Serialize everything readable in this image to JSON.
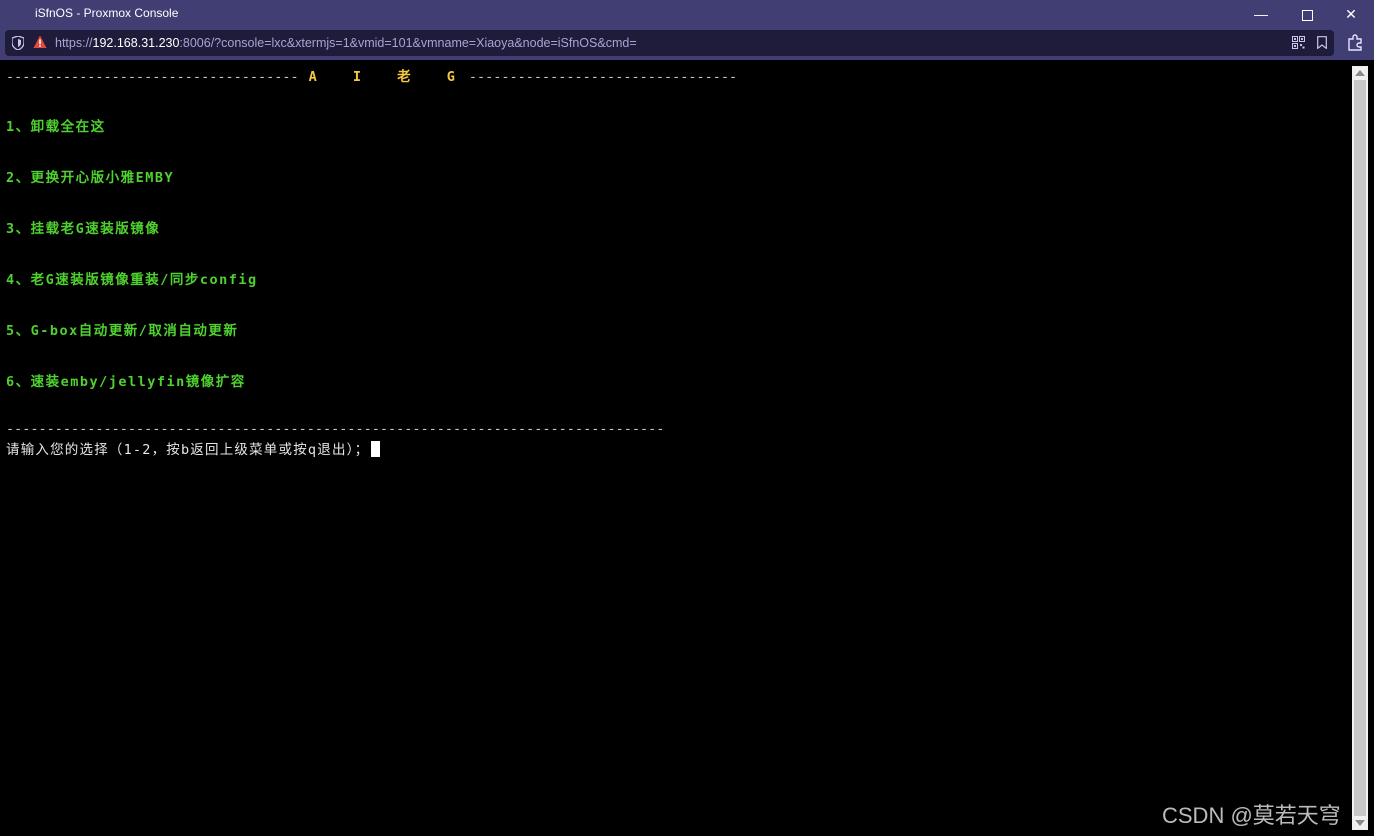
{
  "window": {
    "title": "iSfnOS - Proxmox Console",
    "minimize_glyph": "—",
    "close_glyph": "✕"
  },
  "address_bar": {
    "url_prefix": "https://",
    "url_host": "192.168.31.230",
    "url_rest": ":8006/?console=lxc&xtermjs=1&vmid=101&vmname=Xiaoya&node=iSfnOS&cmd="
  },
  "terminal": {
    "header_dashes_left": "------------------------------------",
    "header_title": "A I 老 G",
    "header_dashes_right": "---------------------------------",
    "menu_items": [
      "1、卸载全在这",
      "2、更换开心版小雅EMBY",
      "3、挂载老G速装版镜像",
      "4、老G速装版镜像重装/同步config",
      "5、G-box自动更新/取消自动更新",
      "6、速装emby/jellyfin镜像扩容"
    ],
    "footer_dashes": "---------------------------------------------------------------------------------",
    "prompt": "请输入您的选择（1-2，按b返回上级菜单或按q退出）；"
  },
  "watermark": "CSDN @莫若天穹",
  "colors": {
    "titlebar": "#413e73",
    "header_title": "#f5c842",
    "menu_text": "#4fd12f",
    "prompt_text": "#e6e6e6"
  }
}
